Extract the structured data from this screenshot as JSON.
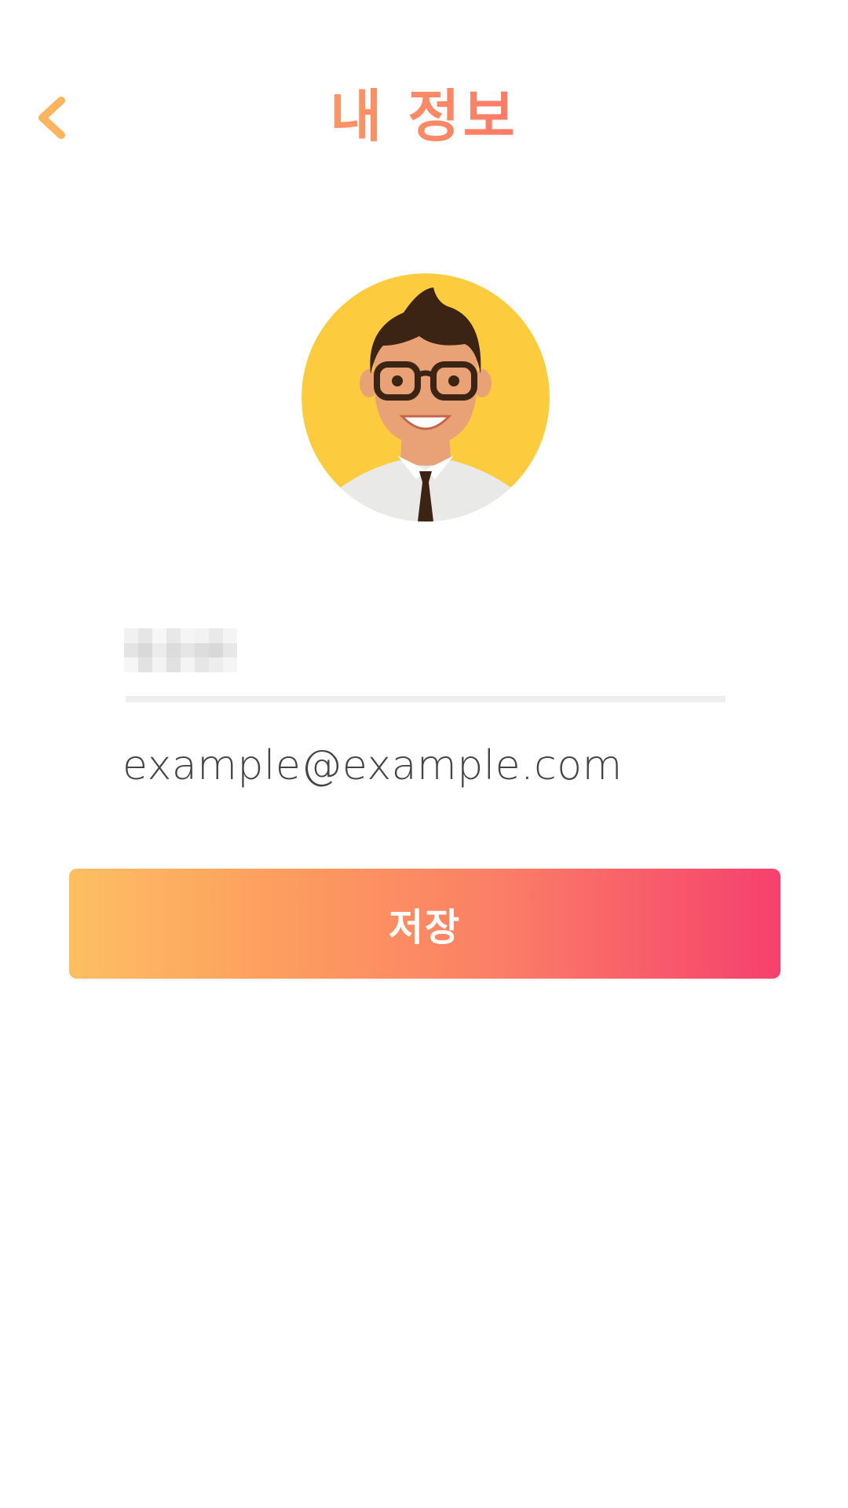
{
  "header": {
    "title": "내 정보",
    "back_icon": "chevron-left-icon",
    "back_color": "#fdb45e"
  },
  "profile": {
    "avatar_icon": "avatar-man-glasses-icon",
    "avatar_bg": "#fdcb3e",
    "name_value": "",
    "email_value": "example@example.com"
  },
  "actions": {
    "save_label": "저장"
  },
  "colors": {
    "accent_start": "#fdbf62",
    "accent_end": "#f5406e",
    "divider": "#eeeeee",
    "text": "#444444"
  }
}
